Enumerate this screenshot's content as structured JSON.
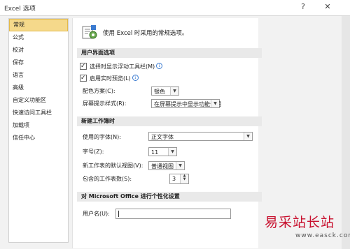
{
  "window": {
    "title": "Excel 选项",
    "help": "?",
    "close": "✕"
  },
  "sidebar": {
    "items": [
      {
        "label": "常规",
        "active": true
      },
      {
        "label": "公式"
      },
      {
        "label": "校对"
      },
      {
        "label": "保存"
      },
      {
        "label": "语言"
      },
      {
        "label": "高级"
      },
      {
        "label": "自定义功能区"
      },
      {
        "label": "快速访问工具栏"
      },
      {
        "label": "加载项"
      },
      {
        "label": "信任中心"
      }
    ]
  },
  "intro": {
    "text": "使用 Excel 时采用的常规选项。",
    "icon": "options-icon"
  },
  "ui_section": {
    "header": "用户界面选项",
    "show_mini_toolbar": {
      "label": "选择时显示浮动工具栏(M)",
      "checked": true
    },
    "live_preview": {
      "label": "启用实时预览(L)",
      "checked": true
    },
    "color_scheme": {
      "label": "配色方案(C):",
      "value": "银色"
    },
    "screentip_style": {
      "label": "屏幕提示样式(R):",
      "value": "在屏幕提示中显示功能说明"
    }
  },
  "workbook_section": {
    "header": "新建工作簿时",
    "font": {
      "label": "使用的字体(N):",
      "value": "正文字体"
    },
    "font_size": {
      "label": "字号(Z):",
      "value": "11"
    },
    "default_view": {
      "label": "新工作表的默认视图(V):",
      "value": "普通视图"
    },
    "sheet_count": {
      "label": "包含的工作表数(S):",
      "value": "3"
    }
  },
  "personalize_section": {
    "header": "对 Microsoft Office 进行个性化设置",
    "username": {
      "label": "用户名(U):",
      "value": ""
    }
  },
  "watermark": {
    "text": "易采站长站",
    "url": "www.easck.com"
  }
}
